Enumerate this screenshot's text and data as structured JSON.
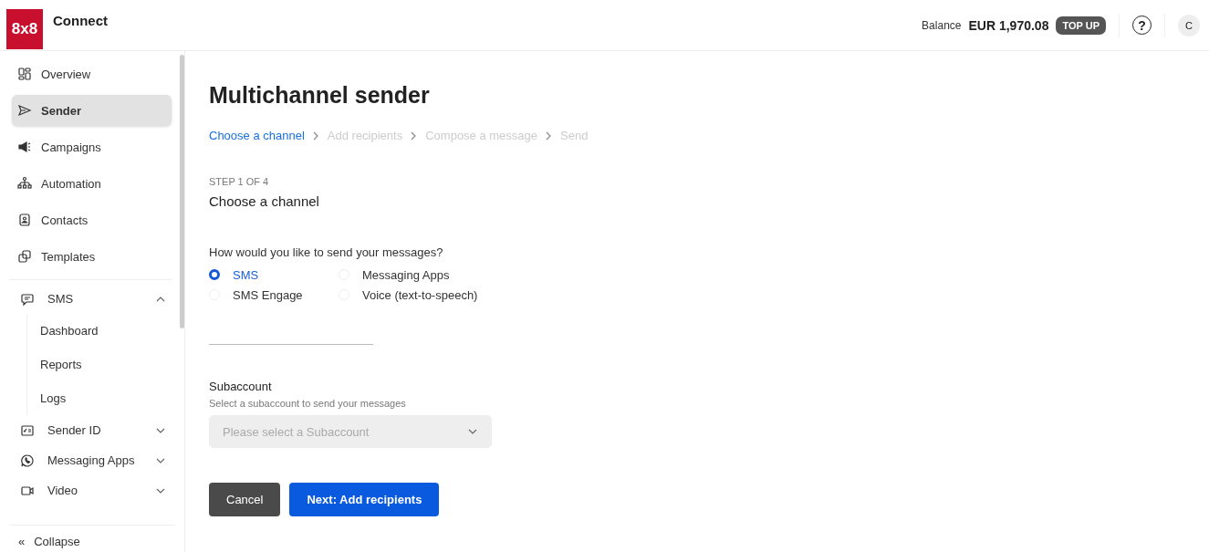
{
  "header": {
    "logo_mark": "8x8",
    "logo_text": "Connect",
    "balance_label": "Balance",
    "balance_amount": "EUR 1,970.08",
    "top_up": "TOP UP",
    "help": "?",
    "avatar": "C"
  },
  "sidebar": {
    "items": [
      {
        "label": "Overview",
        "selected": false
      },
      {
        "label": "Sender",
        "selected": true
      },
      {
        "label": "Campaigns",
        "selected": false
      },
      {
        "label": "Automation",
        "selected": false
      },
      {
        "label": "Contacts",
        "selected": false
      },
      {
        "label": "Templates",
        "selected": false
      }
    ],
    "groups": [
      {
        "label": "SMS",
        "expanded": true,
        "children": [
          {
            "label": "Dashboard"
          },
          {
            "label": "Reports"
          },
          {
            "label": "Logs"
          }
        ]
      },
      {
        "label": "Sender ID",
        "expanded": false
      },
      {
        "label": "Messaging Apps",
        "expanded": false
      },
      {
        "label": "Video",
        "expanded": false
      }
    ],
    "collapse": {
      "icon": "«",
      "label": "Collapse"
    }
  },
  "page": {
    "title": "Multichannel sender",
    "breadcrumb": [
      {
        "label": "Choose a channel",
        "selected": true
      },
      {
        "label": "Add recipients",
        "selected": false
      },
      {
        "label": "Compose a message",
        "selected": false
      },
      {
        "label": "Send",
        "selected": false
      }
    ],
    "step_label": "STEP 1 OF 4",
    "step_title": "Choose a channel",
    "question": "How would you like to send your messages?",
    "channels": [
      {
        "label": "SMS",
        "selected": true
      },
      {
        "label": "SMS Engage",
        "selected": false
      },
      {
        "label": "Messaging Apps",
        "selected": false
      },
      {
        "label": "Voice (text-to-speech)",
        "selected": false
      }
    ],
    "subaccount": {
      "label": "Subaccount",
      "hint": "Select a subaccount to send your messages",
      "placeholder": "Please select a Subaccount",
      "disabled": true
    },
    "buttons": [
      {
        "label": "Cancel",
        "kind": "secondary"
      },
      {
        "label": "Next: Add recipients",
        "kind": "primary"
      }
    ]
  }
}
